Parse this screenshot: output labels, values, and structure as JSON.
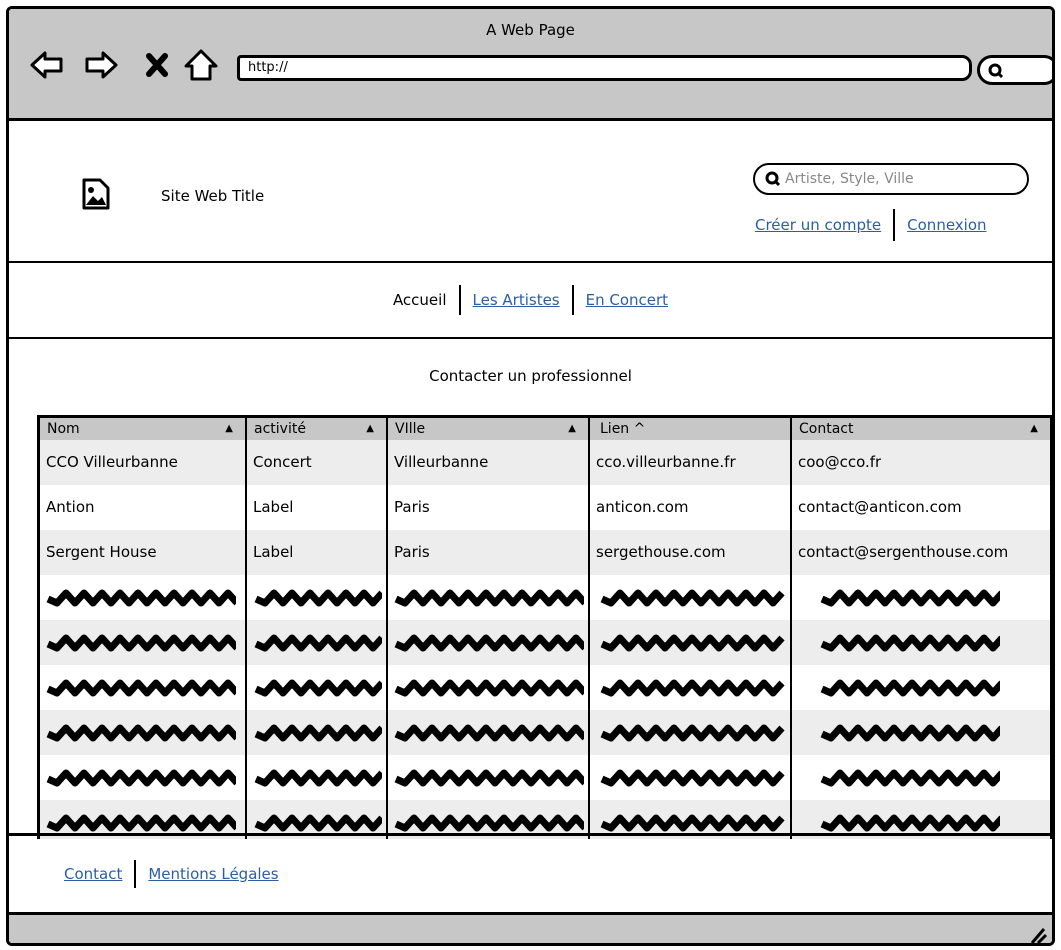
{
  "window": {
    "title": "A Web Page"
  },
  "browser": {
    "url": "http://"
  },
  "header": {
    "site_title": "Site Web Title",
    "search_placeholder": "Artiste, Style, Ville",
    "create_account": "Créer un compte",
    "login": "Connexion"
  },
  "nav": {
    "home": "Accueil",
    "artists": "Les Artistes",
    "concerts": "En Concert"
  },
  "content": {
    "title": "Contacter un professionnel",
    "columns": [
      "Nom",
      "activité",
      "VIlle",
      "Lien ^",
      "Contact"
    ],
    "rows": [
      [
        "CCO Villeurbanne",
        "Concert",
        "Villeurbanne",
        "cco.villeurbanne.fr",
        "coo@cco.fr"
      ],
      [
        "Antion",
        "Label",
        "Paris",
        "anticon.com",
        "contact@anticon.com"
      ],
      [
        "Sergent House",
        "Label",
        "Paris",
        "sergethouse.com",
        "contact@sergenthouse.com"
      ]
    ]
  },
  "footer": {
    "contact": "Contact",
    "legal": "Mentions Légales"
  },
  "colors": {
    "chrome": "#c7c7c7",
    "link": "#2a5fa5",
    "row_alt": "#ededed"
  }
}
